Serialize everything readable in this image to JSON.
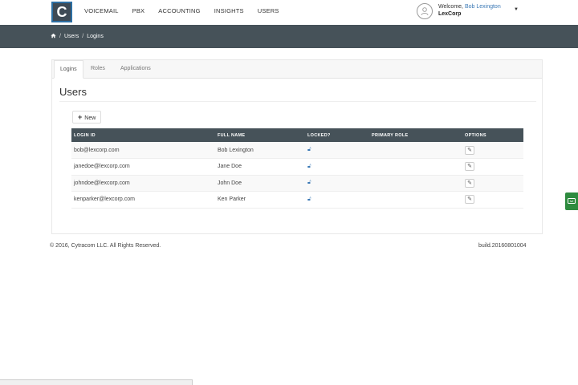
{
  "app": {
    "logo_letter": "C"
  },
  "nav": {
    "items": [
      {
        "label": "VOICEMAIL"
      },
      {
        "label": "PBX"
      },
      {
        "label": "ACCOUNTING"
      },
      {
        "label": "INSIGHTS"
      },
      {
        "label": "USERS"
      }
    ]
  },
  "user": {
    "welcome": "Welcome,",
    "name": "Bob Lexington",
    "org": "LexCorp"
  },
  "breadcrumb": {
    "home_icon": "home-icon",
    "items": [
      "Users",
      "Logins"
    ],
    "separator": "/"
  },
  "tabs": [
    {
      "label": "Logins",
      "active": true
    },
    {
      "label": "Roles",
      "active": false
    },
    {
      "label": "Applications",
      "active": false
    }
  ],
  "page": {
    "title": "Users",
    "new_label": "New"
  },
  "table": {
    "columns": [
      "LOGIN ID",
      "FULL NAME",
      "LOCKED?",
      "PRIMARY ROLE",
      "OPTIONS"
    ],
    "rows": [
      {
        "login": "bob@lexcorp.com",
        "name": "Bob Lexington",
        "role": ""
      },
      {
        "login": "janedoe@lexcorp.com",
        "name": "Jane Doe",
        "role": ""
      },
      {
        "login": "johndoe@lexcorp.com",
        "name": "John Doe",
        "role": ""
      },
      {
        "login": "kenparker@lexcorp.com",
        "name": "Ken Parker",
        "role": ""
      }
    ]
  },
  "footer": {
    "copyright": "© 2016, Cytracom LLC. All Rights Reserved.",
    "build": "build.20160801004"
  },
  "colors": {
    "navbar_dark": "#465259",
    "accent_blue": "#3a78b5",
    "feedback_green": "#2e8b3f"
  }
}
